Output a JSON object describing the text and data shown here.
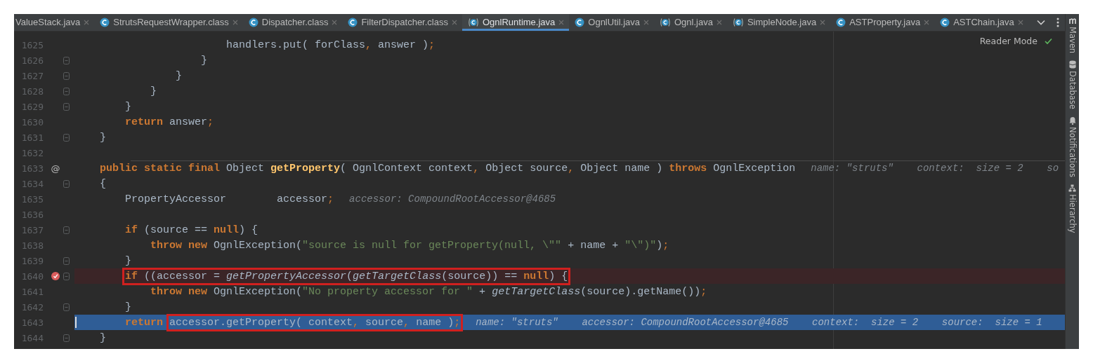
{
  "tabs": [
    {
      "label": "ValueStack.java",
      "kind": "plain",
      "selected": false
    },
    {
      "label": "StrutsRequestWrapper.class",
      "kind": "class",
      "selected": false
    },
    {
      "label": "Dispatcher.class",
      "kind": "class",
      "selected": false
    },
    {
      "label": "FilterDispatcher.class",
      "kind": "class",
      "selected": false
    },
    {
      "label": "OgnlRuntime.java",
      "kind": "source",
      "selected": true
    },
    {
      "label": "OgnlUtil.java",
      "kind": "class",
      "selected": false
    },
    {
      "label": "Ognl.java",
      "kind": "source",
      "selected": false
    },
    {
      "label": "SimpleNode.java",
      "kind": "source",
      "selected": false
    },
    {
      "label": "ASTProperty.java",
      "kind": "class",
      "selected": false
    },
    {
      "label": "ASTChain.java",
      "kind": "class",
      "selected": false
    }
  ],
  "reader_mode": {
    "label": "Reader Mode"
  },
  "tool_windows": [
    {
      "label": "Maven",
      "kind": "maven"
    },
    {
      "label": "Database",
      "kind": "database"
    },
    {
      "label": "Notifications",
      "kind": "bell"
    },
    {
      "label": "Hierarchy",
      "kind": "hierarchy"
    }
  ],
  "lines": [
    {
      "number": "1625",
      "fold": false,
      "breakpoint": false,
      "current": false,
      "code": [
        {
          "kind": "plain",
          "t": "                        handlers.put( forClass"
        },
        {
          "kind": "punct",
          "t": ","
        },
        {
          "kind": "plain",
          "t": " answer )"
        },
        {
          "kind": "punct",
          "t": ";"
        }
      ]
    },
    {
      "number": "1626",
      "fold": true,
      "breakpoint": false,
      "current": false,
      "code": [
        {
          "kind": "plain",
          "t": "                    }"
        }
      ]
    },
    {
      "number": "1627",
      "fold": true,
      "breakpoint": false,
      "current": false,
      "code": [
        {
          "kind": "plain",
          "t": "                }"
        }
      ]
    },
    {
      "number": "1628",
      "fold": true,
      "breakpoint": false,
      "current": false,
      "code": [
        {
          "kind": "plain",
          "t": "            }"
        }
      ]
    },
    {
      "number": "1629",
      "fold": true,
      "breakpoint": false,
      "current": false,
      "code": [
        {
          "kind": "plain",
          "t": "        }"
        }
      ]
    },
    {
      "number": "1630",
      "fold": false,
      "breakpoint": false,
      "current": false,
      "code": [
        {
          "kind": "keyword",
          "t": "        return"
        },
        {
          "kind": "plain",
          "t": " answer"
        },
        {
          "kind": "punct",
          "t": ";"
        }
      ]
    },
    {
      "number": "1631",
      "fold": true,
      "breakpoint": false,
      "current": false,
      "code": [
        {
          "kind": "plain",
          "t": "    }"
        }
      ]
    },
    {
      "number": "1632",
      "fold": false,
      "breakpoint": false,
      "current": false
    },
    {
      "number": "1633",
      "gutter_mark": "@",
      "separator": true,
      "fold": false,
      "breakpoint": false,
      "current": false,
      "code": [
        {
          "kind": "keyword",
          "t": "    public static final"
        },
        {
          "kind": "plain",
          "t": " Object "
        },
        {
          "kind": "method",
          "t": "getProperty"
        },
        {
          "kind": "plain",
          "t": "( OgnlContext context"
        },
        {
          "kind": "punct",
          "t": ","
        },
        {
          "kind": "plain",
          "t": " Object source"
        },
        {
          "kind": "punct",
          "t": ","
        },
        {
          "kind": "plain",
          "t": " Object name ) "
        },
        {
          "kind": "keyword",
          "t": "throws"
        },
        {
          "kind": "plain",
          "t": " OgnlException"
        }
      ],
      "hint": "name: \"struts\"    context:  size = 2    so"
    },
    {
      "number": "1634",
      "fold": true,
      "breakpoint": false,
      "current": false,
      "code": [
        {
          "kind": "plain",
          "t": "    {"
        }
      ]
    },
    {
      "number": "1635",
      "fold": false,
      "breakpoint": false,
      "current": false,
      "code": [
        {
          "kind": "plain",
          "t": "        PropertyAccessor        accessor"
        },
        {
          "kind": "punct",
          "t": ";"
        }
      ],
      "hint": "accessor: CompoundRootAccessor@4685"
    },
    {
      "number": "1636",
      "fold": false,
      "breakpoint": false,
      "current": false
    },
    {
      "number": "1637",
      "fold": true,
      "breakpoint": false,
      "current": false,
      "code": [
        {
          "kind": "keyword",
          "t": "        if"
        },
        {
          "kind": "plain",
          "t": " (source == "
        },
        {
          "kind": "keyword",
          "t": "null"
        },
        {
          "kind": "plain",
          "t": ") {"
        }
      ]
    },
    {
      "number": "1638",
      "fold": false,
      "breakpoint": false,
      "current": false,
      "code": [
        {
          "kind": "keyword",
          "t": "            throw new"
        },
        {
          "kind": "plain",
          "t": " OgnlException("
        },
        {
          "kind": "string",
          "t": "\"source is null for getProperty(null, \\\"\""
        },
        {
          "kind": "plain",
          "t": " + name + "
        },
        {
          "kind": "string",
          "t": "\"\\\")\""
        },
        {
          "kind": "plain",
          "t": ")"
        },
        {
          "kind": "punct",
          "t": ";"
        }
      ]
    },
    {
      "number": "1639",
      "fold": true,
      "breakpoint": false,
      "current": false,
      "code": [
        {
          "kind": "plain",
          "t": "        }"
        }
      ]
    },
    {
      "number": "1640",
      "fold": true,
      "breakpoint": true,
      "current": false,
      "code": [
        {
          "kind": "box",
          "tokens": [
            {
              "kind": "keyword",
              "t": "        if"
            },
            {
              "kind": "plain",
              "t": " ((accessor = "
            },
            {
              "kind": "call",
              "t": "getPropertyAccessor"
            },
            {
              "kind": "plain",
              "t": "("
            },
            {
              "kind": "call",
              "t": "getTargetClass"
            },
            {
              "kind": "plain",
              "t": "(source)) == "
            },
            {
              "kind": "keyword",
              "t": "null"
            },
            {
              "kind": "plain",
              "t": ") {"
            }
          ]
        }
      ]
    },
    {
      "number": "1641",
      "fold": false,
      "breakpoint": false,
      "current": false,
      "code": [
        {
          "kind": "keyword",
          "t": "            throw new"
        },
        {
          "kind": "plain",
          "t": " OgnlException("
        },
        {
          "kind": "string",
          "t": "\"No property accessor for \""
        },
        {
          "kind": "plain",
          "t": " + "
        },
        {
          "kind": "call",
          "t": "getTargetClass"
        },
        {
          "kind": "plain",
          "t": "(source).getName())"
        },
        {
          "kind": "punct",
          "t": ";"
        }
      ]
    },
    {
      "number": "1642",
      "fold": true,
      "breakpoint": false,
      "current": false,
      "code": [
        {
          "kind": "plain",
          "t": "        }"
        }
      ]
    },
    {
      "number": "1643",
      "fold": false,
      "breakpoint": false,
      "current": true,
      "code": [
        {
          "kind": "keyword",
          "t": "        return "
        },
        {
          "kind": "box",
          "tokens": [
            {
              "kind": "plain",
              "t": "accessor.getProperty( context"
            },
            {
              "kind": "punct",
              "t": ","
            },
            {
              "kind": "plain",
              "t": " source"
            },
            {
              "kind": "punct",
              "t": ","
            },
            {
              "kind": "plain",
              "t": " name )"
            },
            {
              "kind": "punct",
              "t": ";"
            }
          ]
        }
      ],
      "hint": "name: \"struts\"    accessor: CompoundRootAccessor@4685    context:  size = 2    source:  size = 1"
    },
    {
      "number": "1644",
      "fold": true,
      "breakpoint": false,
      "current": false,
      "code": [
        {
          "kind": "plain",
          "t": "    }"
        }
      ]
    }
  ]
}
